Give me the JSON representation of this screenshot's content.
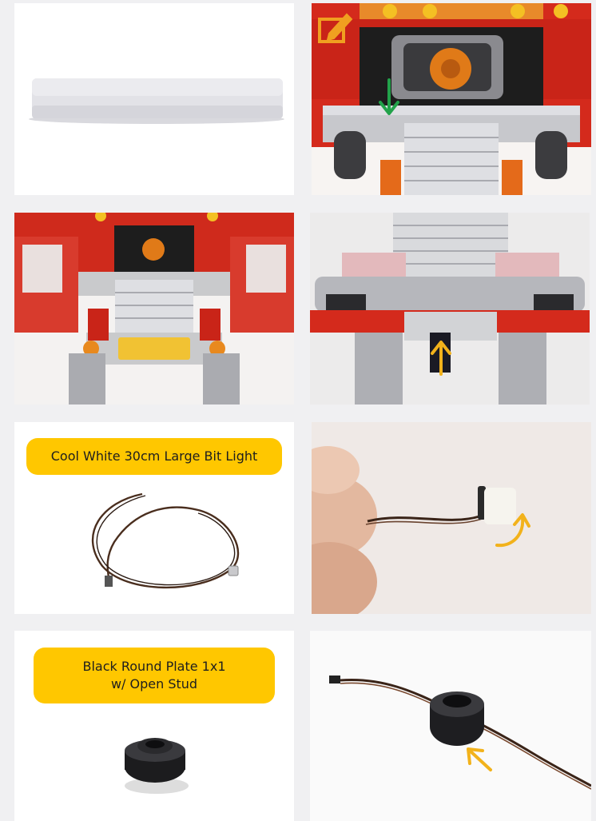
{
  "panels": {
    "p5_label": "Cool White 30cm Large Bit Light",
    "p7_label_line1": "Black Round Plate 1x1",
    "p7_label_line2": "w/ Open Stud"
  },
  "colors": {
    "background": "#f0f0f2",
    "label_bg": "#ffc700",
    "arrow_green": "#22a24a",
    "arrow_yellow": "#f2b21b",
    "edit_icon": "#f0a020",
    "brick_red": "#d42a1c",
    "brick_grey": "#c9cacc"
  },
  "icons": [
    "edit-icon",
    "arrow-down-icon",
    "arrow-up-icon",
    "curved-arrow-icon",
    "arrow-diagonal-icon"
  ]
}
